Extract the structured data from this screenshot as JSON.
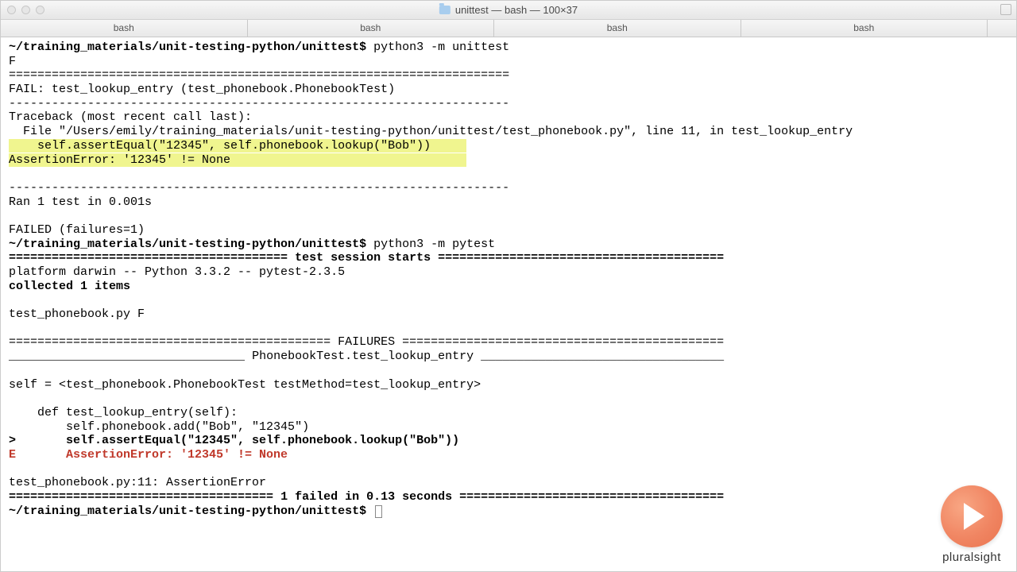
{
  "titlebar": {
    "title": "unittest — bash — 100×37"
  },
  "tabs": [
    "bash",
    "bash",
    "bash",
    "bash",
    ""
  ],
  "t": {
    "prompt_path": "~/training_materials/unit-testing-python/unittest",
    "dollar": "$",
    "cmd1": " python3 -m unittest",
    "f": "F",
    "dashes": "======================================================================",
    "fail_line": "FAIL: test_lookup_entry (test_phonebook.PhonebookTest)",
    "sep_small": "----------------------------------------------------------------------",
    "tb_head": "Traceback (most recent call last):",
    "tb_file": "  File \"/Users/emily/training_materials/unit-testing-python/unittest/test_phonebook.py\", line 11, in test_lookup_entry",
    "hl1": "    self.assertEqual(\"12345\", self.phonebook.lookup(\"Bob\"))",
    "hl1_pad": "     ",
    "hl2": "AssertionError: '12345' != None",
    "hl2_pad": "                                 ",
    "ran": "Ran 1 test in 0.001s",
    "failed": "FAILED (failures=1)",
    "cmd2": " python3 -m pytest",
    "sess_eq_l": "======================================= ",
    "sess_label": "test session starts",
    "sess_eq_r": " ========================================",
    "platform": "platform darwin -- Python 3.3.2 -- pytest-2.3.5",
    "collected": "collected 1 items",
    "pyfile": "test_phonebook.py F",
    "fail_eq_l": "============================================= ",
    "fail_label": "FAILURES",
    "fail_eq_r": " =============================================",
    "und_l": "_________________________________ ",
    "und_label": "PhonebookTest.test_lookup_entry",
    "und_r": " __________________________________",
    "selfeq": "self = <test_phonebook.PhonebookTest testMethod=test_lookup_entry>",
    "def": "    def test_lookup_entry(self):",
    "addline": "        self.phonebook.add(\"Bob\", \"12345\")",
    "gtline": ">       self.assertEqual(\"12345\", self.phonebook.lookup(\"Bob\"))",
    "e_line": "E       AssertionError: '12345' != None",
    "loc": "test_phonebook.py:11: AssertionError",
    "sum_eq_l": "===================================== ",
    "sum_label": "1 failed in 0.13 seconds",
    "sum_eq_r": " ====================================="
  },
  "brand": "pluralsight"
}
